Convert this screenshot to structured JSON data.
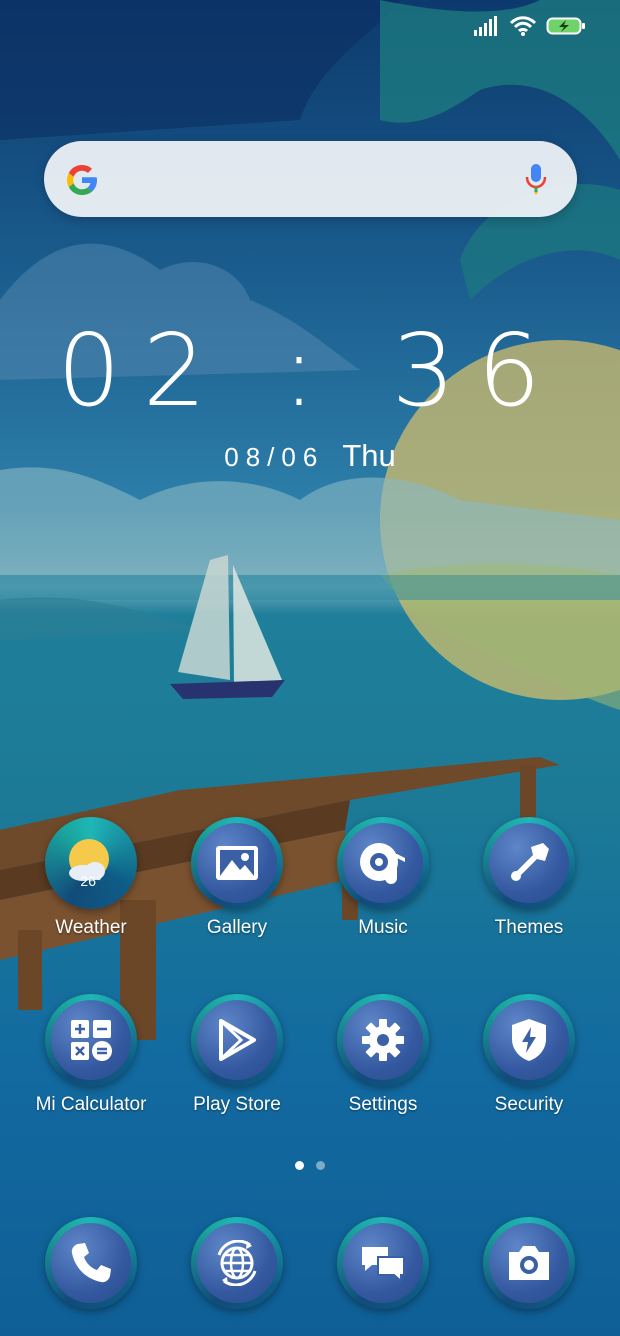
{
  "status": {
    "signal_icon": "signal-bars-icon",
    "wifi_icon": "wifi-icon",
    "battery_icon": "battery-charging-icon",
    "battery_color": "#6fd36a"
  },
  "search": {
    "logo_icon": "google-logo-icon",
    "mic_icon": "mic-icon"
  },
  "clock": {
    "time": "02 : 36",
    "date": "08/06",
    "weekday": "Thu"
  },
  "apps": [
    {
      "label": "Weather",
      "icon": "weather-icon",
      "badge": "26°"
    },
    {
      "label": "Gallery",
      "icon": "gallery-icon"
    },
    {
      "label": "Music",
      "icon": "music-icon"
    },
    {
      "label": "Themes",
      "icon": "brush-icon"
    },
    {
      "label": "Mi Calculator",
      "icon": "calculator-icon"
    },
    {
      "label": "Play Store",
      "icon": "play-store-icon"
    },
    {
      "label": "Settings",
      "icon": "gear-icon"
    },
    {
      "label": "Security",
      "icon": "shield-icon"
    }
  ],
  "pages": {
    "count": 2,
    "active": 1
  },
  "dock": [
    {
      "icon": "phone-icon"
    },
    {
      "icon": "browser-icon"
    },
    {
      "icon": "messages-icon"
    },
    {
      "icon": "camera-icon"
    }
  ],
  "colors": {
    "icon_ring": "#1fb6b6",
    "icon_fill": "#3459a0",
    "sky": "#0d3a6e",
    "sea": "#1c7a96"
  }
}
